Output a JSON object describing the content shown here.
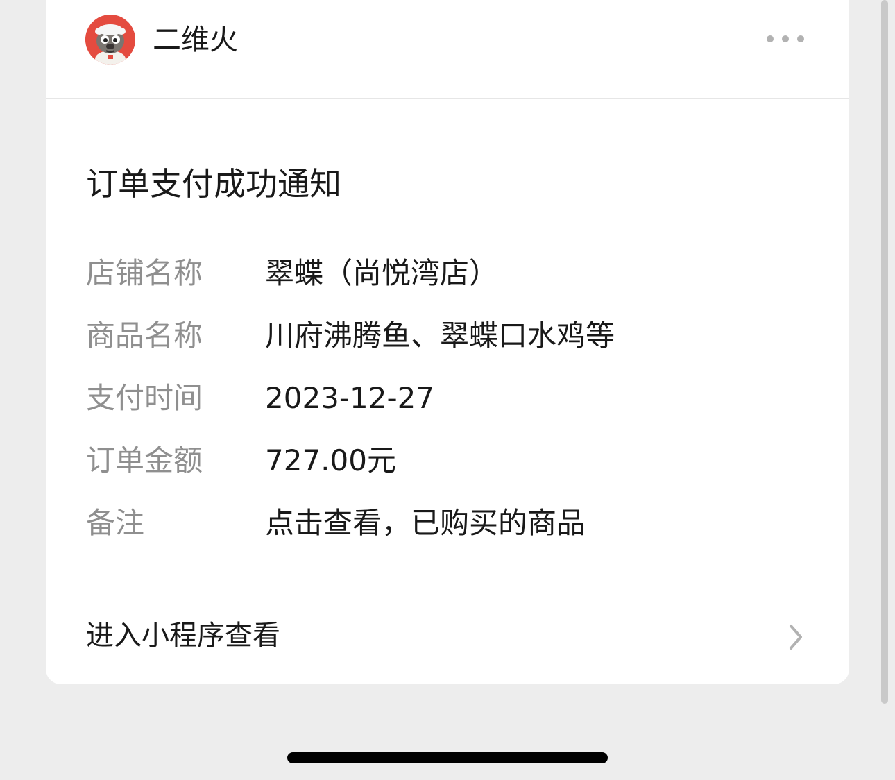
{
  "header": {
    "account_name": "二维火"
  },
  "notice": {
    "title": "订单支付成功通知",
    "fields": [
      {
        "label": "店铺名称",
        "value": "翠蝶（尚悦湾店）"
      },
      {
        "label": "商品名称",
        "value": "川府沸腾鱼、翠蝶口水鸡等"
      },
      {
        "label": "支付时间",
        "value": "2023-12-27"
      },
      {
        "label": "订单金额",
        "value": "727.00元"
      },
      {
        "label": "备注",
        "value": "点击查看，已购买的商品"
      }
    ],
    "enter_label": "进入小程序查看"
  },
  "colors": {
    "page_bg": "#ededed",
    "card_bg": "#ffffff",
    "label_gray": "#8f8f8f",
    "text_dark": "#191919",
    "avatar_red": "#e6453f"
  },
  "icons": {
    "avatar": "cartoon-mascot-avatar",
    "more": "more-dots-icon",
    "chevron": "chevron-right-icon"
  }
}
